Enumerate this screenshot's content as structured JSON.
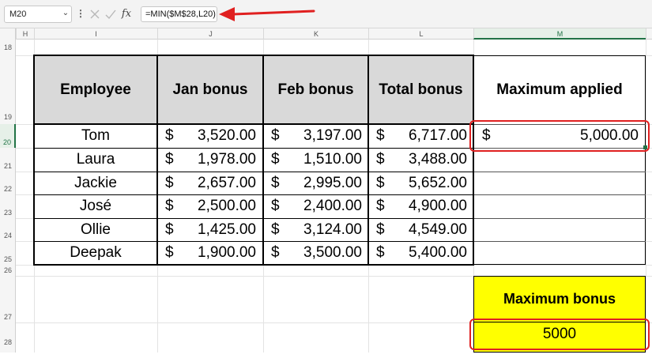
{
  "formula_bar": {
    "name_box": "M20",
    "name_box_dropdown_icon": "chevron-down-icon",
    "formula": "=MIN($M$28,L20)"
  },
  "columns": [
    "H",
    "I",
    "J",
    "K",
    "L",
    "M"
  ],
  "rows": [
    "18",
    "19",
    "20",
    "21",
    "22",
    "23",
    "24",
    "25",
    "26",
    "27",
    "28"
  ],
  "table": {
    "headers": [
      "Employee",
      "Jan bonus",
      "Feb bonus",
      "Total bonus",
      "Maximum applied"
    ],
    "currency_symbol": "$",
    "rows": [
      {
        "name": "Tom",
        "jan": "3,520.00",
        "feb": "3,197.00",
        "total": "6,717.00",
        "max": "5,000.00"
      },
      {
        "name": "Laura",
        "jan": "1,978.00",
        "feb": "1,510.00",
        "total": "3,488.00",
        "max": ""
      },
      {
        "name": "Jackie",
        "jan": "2,657.00",
        "feb": "2,995.00",
        "total": "5,652.00",
        "max": ""
      },
      {
        "name": "José",
        "jan": "2,500.00",
        "feb": "2,400.00",
        "total": "4,900.00",
        "max": ""
      },
      {
        "name": "Ollie",
        "jan": "1,425.00",
        "feb": "3,124.00",
        "total": "4,549.00",
        "max": ""
      },
      {
        "name": "Deepak",
        "jan": "1,900.00",
        "feb": "3,500.00",
        "total": "5,400.00",
        "max": ""
      }
    ]
  },
  "max_bonus": {
    "label": "Maximum bonus",
    "value": "5000"
  },
  "colors": {
    "header_fill": "#d9d9d9",
    "highlight_fill": "#ffff00",
    "annotation_red": "#e02020",
    "active_green": "#217346"
  }
}
